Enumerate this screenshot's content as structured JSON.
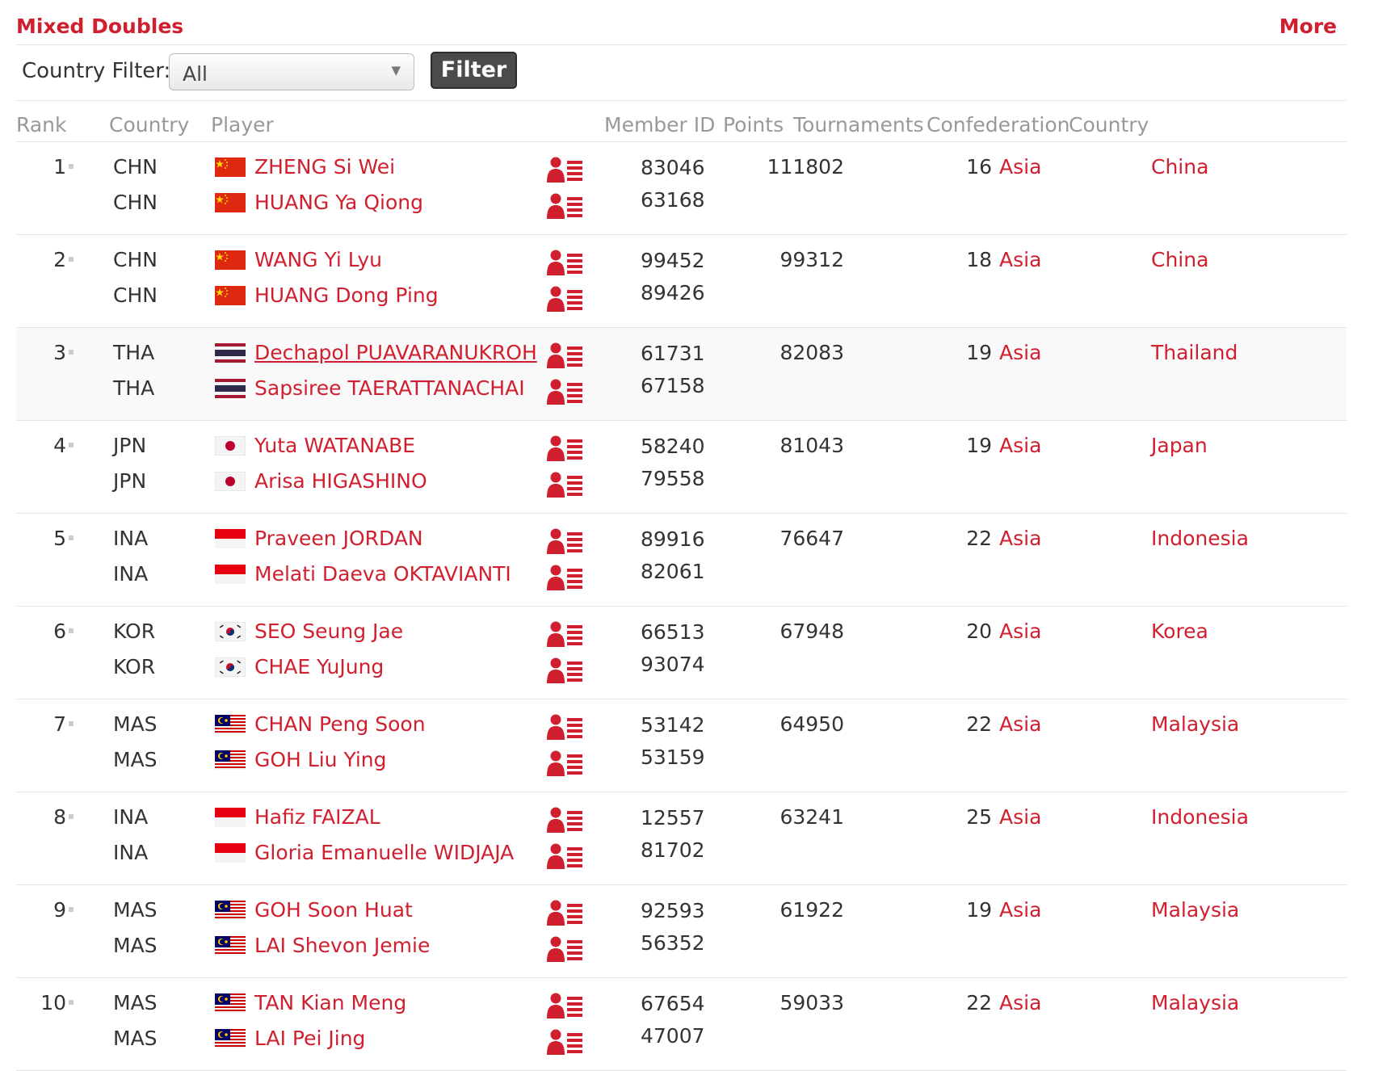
{
  "header": {
    "title": "Mixed Doubles",
    "more_label": "More"
  },
  "filter": {
    "label": "Country Filter:",
    "selected": "All",
    "button_label": "Filter"
  },
  "columns": {
    "rank": "Rank",
    "country": "Country",
    "player": "Player",
    "member_id": "Member ID",
    "points": "Points",
    "tournaments": "Tournaments",
    "confederation": "Confederation",
    "country2": "Country"
  },
  "icons": {
    "player_profile": "player-profile-icon",
    "rank_change": "rank-change-icon"
  },
  "colors": {
    "accent": "#d0202f",
    "button": "#4b4b4b",
    "muted": "#999999"
  },
  "rows": [
    {
      "rank": "1",
      "points": "111802",
      "tournaments": "16",
      "confederation": "Asia",
      "country": "China",
      "players": [
        {
          "code": "CHN",
          "name": "ZHENG Si Wei",
          "member_id": "83046",
          "flag": "china-flag"
        },
        {
          "code": "CHN",
          "name": "HUANG Ya Qiong",
          "member_id": "63168",
          "flag": "china-flag"
        }
      ]
    },
    {
      "rank": "2",
      "points": "99312",
      "tournaments": "18",
      "confederation": "Asia",
      "country": "China",
      "players": [
        {
          "code": "CHN",
          "name": "WANG Yi Lyu",
          "member_id": "99452",
          "flag": "china-flag"
        },
        {
          "code": "CHN",
          "name": "HUANG Dong Ping",
          "member_id": "89426",
          "flag": "china-flag"
        }
      ]
    },
    {
      "rank": "3",
      "points": "82083",
      "tournaments": "19",
      "confederation": "Asia",
      "country": "Thailand",
      "players": [
        {
          "code": "THA",
          "name": "Dechapol PUAVARANUKROH",
          "member_id": "61731",
          "flag": "thailand-flag"
        },
        {
          "code": "THA",
          "name": "Sapsiree TAERATTANACHAI",
          "member_id": "67158",
          "flag": "thailand-flag"
        }
      ]
    },
    {
      "rank": "4",
      "points": "81043",
      "tournaments": "19",
      "confederation": "Asia",
      "country": "Japan",
      "players": [
        {
          "code": "JPN",
          "name": "Yuta WATANABE",
          "member_id": "58240",
          "flag": "japan-flag"
        },
        {
          "code": "JPN",
          "name": "Arisa HIGASHINO",
          "member_id": "79558",
          "flag": "japan-flag"
        }
      ]
    },
    {
      "rank": "5",
      "points": "76647",
      "tournaments": "22",
      "confederation": "Asia",
      "country": "Indonesia",
      "players": [
        {
          "code": "INA",
          "name": "Praveen JORDAN",
          "member_id": "89916",
          "flag": "indonesia-flag"
        },
        {
          "code": "INA",
          "name": "Melati Daeva OKTAVIANTI",
          "member_id": "82061",
          "flag": "indonesia-flag"
        }
      ]
    },
    {
      "rank": "6",
      "points": "67948",
      "tournaments": "20",
      "confederation": "Asia",
      "country": "Korea",
      "players": [
        {
          "code": "KOR",
          "name": "SEO Seung Jae",
          "member_id": "66513",
          "flag": "korea-flag"
        },
        {
          "code": "KOR",
          "name": "CHAE YuJung",
          "member_id": "93074",
          "flag": "korea-flag"
        }
      ]
    },
    {
      "rank": "7",
      "points": "64950",
      "tournaments": "22",
      "confederation": "Asia",
      "country": "Malaysia",
      "players": [
        {
          "code": "MAS",
          "name": "CHAN Peng Soon",
          "member_id": "53142",
          "flag": "malaysia-flag"
        },
        {
          "code": "MAS",
          "name": "GOH Liu Ying",
          "member_id": "53159",
          "flag": "malaysia-flag"
        }
      ]
    },
    {
      "rank": "8",
      "points": "63241",
      "tournaments": "25",
      "confederation": "Asia",
      "country": "Indonesia",
      "players": [
        {
          "code": "INA",
          "name": "Hafiz FAIZAL",
          "member_id": "12557",
          "flag": "indonesia-flag"
        },
        {
          "code": "INA",
          "name": "Gloria Emanuelle WIDJAJA",
          "member_id": "81702",
          "flag": "indonesia-flag"
        }
      ]
    },
    {
      "rank": "9",
      "points": "61922",
      "tournaments": "19",
      "confederation": "Asia",
      "country": "Malaysia",
      "players": [
        {
          "code": "MAS",
          "name": "GOH Soon Huat",
          "member_id": "92593",
          "flag": "malaysia-flag"
        },
        {
          "code": "MAS",
          "name": "LAI Shevon Jemie",
          "member_id": "56352",
          "flag": "malaysia-flag"
        }
      ]
    },
    {
      "rank": "10",
      "points": "59033",
      "tournaments": "22",
      "confederation": "Asia",
      "country": "Malaysia",
      "players": [
        {
          "code": "MAS",
          "name": "TAN Kian Meng",
          "member_id": "67654",
          "flag": "malaysia-flag"
        },
        {
          "code": "MAS",
          "name": "LAI Pei Jing",
          "member_id": "47007",
          "flag": "malaysia-flag"
        }
      ]
    }
  ]
}
